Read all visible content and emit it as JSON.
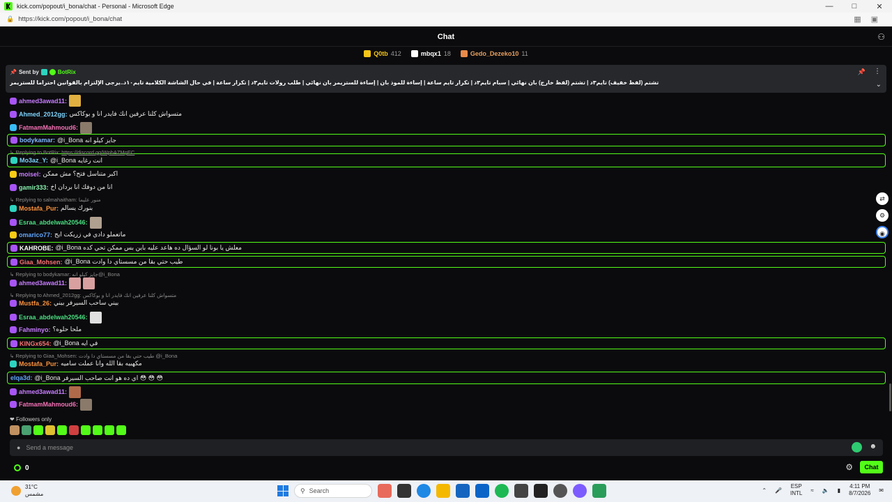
{
  "browser": {
    "window_title": "kick.com/popout/i_bona/chat - Personal - Microsoft Edge",
    "url": "https://kick.com/popout/i_bona/chat"
  },
  "chat": {
    "title": "Chat"
  },
  "leaderboard": [
    {
      "name": "Q0tb",
      "count": "412",
      "color": "#f5c518"
    },
    {
      "name": "mbqx1",
      "count": "18",
      "color": "#ffffff"
    },
    {
      "name": "Gedo_Dezeko10",
      "count": "11",
      "color": "#e88a4a"
    }
  ],
  "pinned": {
    "sent_by_label": "Sent by",
    "sender": "BotRix",
    "text": "تشتم (لفظ خفيف) تايم٣د | تشتم (لفظ خارج) بان نهائي | سبام تايم٣د | تكرار تايم ساعة | إساءة للموذ بان | إساءة للستريمر بان نهائي | طلب رولات تايم٣د | تكرار ساعة | في حال الشاشة الكلامية تايم١٠د..يرجى الإلتزام بالقوانين احتراما للستريمر"
  },
  "messages": [
    {
      "user": "ahmed3awad11",
      "color": "#c77dff",
      "badge": "#a855f7",
      "text": "",
      "emotes": [
        "#e0b040"
      ]
    },
    {
      "user": "Ahmed_2012gg",
      "color": "#7dd3fc",
      "badge": "#a855f7",
      "text": "متسواش كلنا عرفين انك فايدر انا و بوكاكس",
      "emotes": []
    },
    {
      "user": "FatmamMahmoud6",
      "color": "#f472b6",
      "badge": "#38bdf8",
      "text": "",
      "emotes": [
        "#8a7a6a"
      ]
    },
    {
      "user": "bodykamar",
      "color": "#7db7ff",
      "badge": "#a855f7",
      "text": "@i_Bona جايز كيلو انه",
      "emotes": [],
      "hl": true
    },
    {
      "user": "Mo3az_Y",
      "color": "#7dd3fc",
      "badge": "#2dd4bf",
      "text": "@i_Bona انت رغايه",
      "emotes": [],
      "hl": true
    },
    {
      "user": "moisel",
      "color": "#c77dff",
      "badge": "#facc15",
      "text": "اكبر متناسل فتح؟ مش ممكن",
      "emotes": []
    },
    {
      "user": "gamir333",
      "color": "#86efac",
      "badge": "#a855f7",
      "text": "انا من دوفك انا بردان اخ",
      "emotes": []
    },
    {
      "user": "Mostafa_Pur",
      "color": "#fb923c",
      "badge": "#2dd4bf",
      "text": "بنورك يسالم",
      "emotes": []
    },
    {
      "user": "Esraa_abdelwah20546",
      "color": "#4ade80",
      "badge": "#a855f7",
      "text": "",
      "emotes": [
        "#b0a090"
      ]
    },
    {
      "user": "omarico77",
      "color": "#60a5fa",
      "badge": "#facc15",
      "text": "ماتعملو دادي في زريكت ايج",
      "emotes": []
    },
    {
      "user": "KAHROBE",
      "color": "#ffffff",
      "badge": "#a855f7",
      "text": "@i_Bona معلش يا بونا لو السؤال ده هاعد عليه باين بس ممكن تحي كده",
      "emotes": [],
      "hl": true
    },
    {
      "user": "Giaa_Mohsen",
      "color": "#f87171",
      "badge": "#a855f7",
      "text": "@i_Bona طيب حتي بقا من مسستاي دا وادت",
      "emotes": [],
      "hl": true
    },
    {
      "user": "ahmed3awad11",
      "color": "#c77dff",
      "badge": "#a855f7",
      "text": "",
      "emotes": [
        "#d9a0a0",
        "#d9a0a0"
      ]
    },
    {
      "user": "Mustfa_26",
      "color": "#fb923c",
      "badge": "#a855f7",
      "text": "بيني ساحب السيرفر بيني",
      "emotes": []
    },
    {
      "user": "Esraa_abdelwah20546",
      "color": "#4ade80",
      "badge": "#a855f7",
      "text": "",
      "emotes": [
        "#e0e0e0"
      ]
    },
    {
      "user": "Fahminyo",
      "color": "#c77dff",
      "badge": "#a855f7",
      "text": "ملحا حلوه؟",
      "emotes": []
    },
    {
      "user": "KINGx654",
      "color": "#f87171",
      "badge": "#a855f7",
      "text": "@i_Bona في ايه",
      "emotes": [],
      "hl": true
    },
    {
      "user": "Mostafa_Pur",
      "color": "#fb923c",
      "badge": "#2dd4bf",
      "text": "مكهبيه بقا الله وانا عملت ساميه",
      "emotes": []
    },
    {
      "user": "elqa3d",
      "color": "#60a5fa",
      "badge": "",
      "text": "@i_Bona اي ده هو انت صاحب السيرفر 😳 😳 😳",
      "emotes": [],
      "hl": true
    },
    {
      "user": "ahmed3awad11",
      "color": "#c77dff",
      "badge": "#a855f7",
      "text": "",
      "emotes": [
        "#b06a4a"
      ]
    },
    {
      "user": "FatmamMahmoud6",
      "color": "#f472b6",
      "badge": "#a855f7",
      "text": "",
      "emotes": [
        "#8a7a6a"
      ]
    }
  ],
  "replies": [
    {
      "label": "Replying to BotRix:",
      "link": "https://discord.gg/WpbAZMgEC"
    },
    {
      "label": "Replying to salmahaitham:",
      "quote": "منور عليما"
    },
    {
      "label": "Replying to bodykamar:",
      "quote": "جايز كيلو انه@i_Bona"
    },
    {
      "label": "Replying to Ahmed_2012gg:",
      "quote": "متسواش كلنا عرفين انك فايدر انا و بوكاكس"
    },
    {
      "label": "Replying to Giaa_Mohsen:",
      "quote": "طيب حتي بقا من مسستاي دا وادت @i_Bona"
    }
  ],
  "followers_only": "Followers only",
  "input": {
    "placeholder": "Send a message"
  },
  "bottom": {
    "points": "0",
    "chat_button": "Chat"
  },
  "taskbar": {
    "temperature": "31°C",
    "weather": "مشمس",
    "search": "Search",
    "language": "ESP",
    "layout": "INTL",
    "time": "4:11 PM",
    "date": "8/7/2026"
  }
}
